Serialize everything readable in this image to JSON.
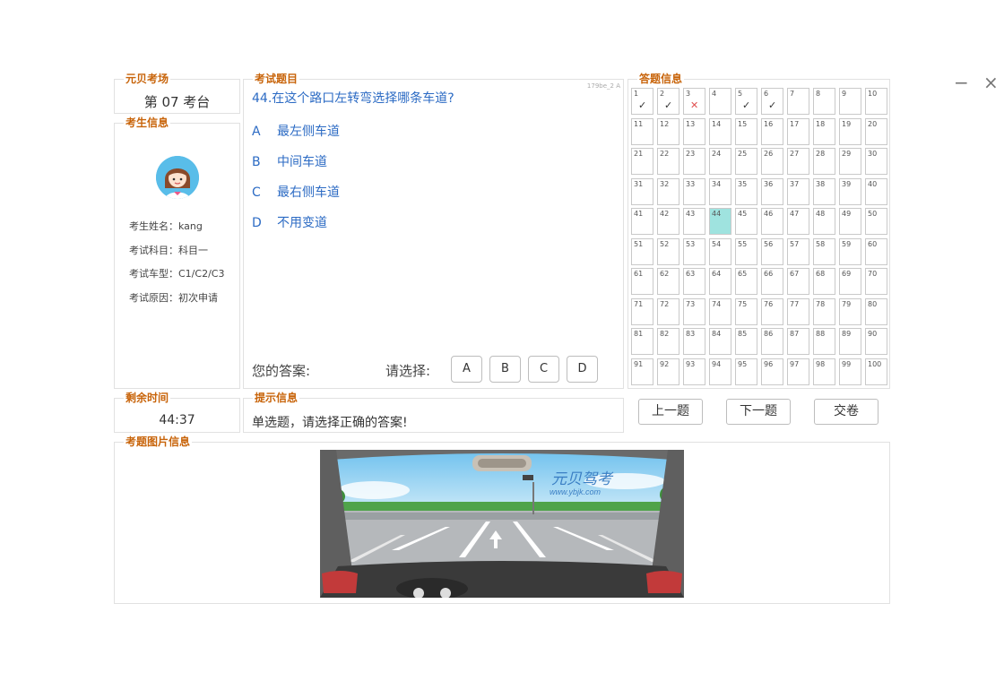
{
  "window": {
    "minimize_glyph": "−",
    "close_glyph": "×"
  },
  "venue": {
    "title": "元贝考场",
    "station": "第 07 考台"
  },
  "examinee": {
    "title": "考生信息",
    "rows": [
      {
        "text": "考生姓名：kang"
      },
      {
        "text": "考试科目：科目一"
      },
      {
        "text": "考试车型：C1/C2/C3"
      },
      {
        "text": "考试原因：初次申请"
      }
    ]
  },
  "time": {
    "title": "剩余时间",
    "remaining": "44:37"
  },
  "question": {
    "title": "考试题目",
    "id": "179be_2 A",
    "text": "44.在这个路口左转弯选择哪条车道?",
    "options": [
      {
        "letter": "A",
        "text": "最左侧车道"
      },
      {
        "letter": "B",
        "text": "中间车道"
      },
      {
        "letter": "C",
        "text": "最右侧车道"
      },
      {
        "letter": "D",
        "text": "不用变道"
      }
    ],
    "your_answer_label": "您的答案:",
    "select_label": "请选择:",
    "answer_buttons": [
      "A",
      "B",
      "C",
      "D"
    ]
  },
  "answer_grid": {
    "title": "答题信息",
    "current": 44,
    "count": 100,
    "marks": {
      "1": "✓",
      "2": "✓",
      "3": "✕",
      "5": "✓",
      "6": "✓"
    },
    "mark_types": {
      "1": "ok",
      "2": "ok",
      "3": "bad",
      "5": "ok",
      "6": "ok"
    }
  },
  "hint": {
    "title": "提示信息",
    "text": "单选题，请选择正确的答案!"
  },
  "nav": {
    "prev": "上一题",
    "next": "下一题",
    "submit": "交卷"
  },
  "picture": {
    "title": "考题图片信息",
    "watermark_brand": "元贝驾考",
    "watermark_url": "www.ybjk.com"
  },
  "colors": {
    "accent": "#c8640a",
    "question_blue": "#2c6bc4",
    "current_cell": "#9fe3df",
    "wrong": "#e05050"
  }
}
